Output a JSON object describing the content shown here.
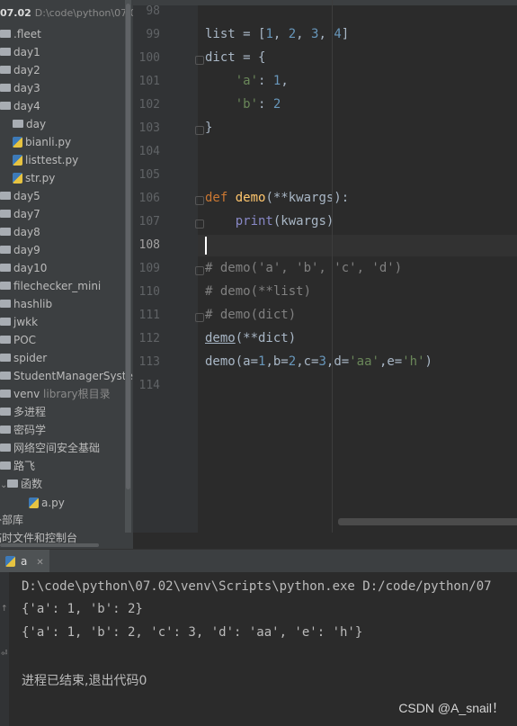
{
  "project": {
    "root_name": "07.02",
    "root_path": "D:\\code\\python\\07.0",
    "items": [
      {
        "label": ".fleet",
        "type": "folder"
      },
      {
        "label": "day1",
        "type": "folder"
      },
      {
        "label": "day2",
        "type": "folder"
      },
      {
        "label": "day3",
        "type": "folder"
      },
      {
        "label": "day4",
        "type": "folder"
      },
      {
        "label": "day",
        "type": "folder"
      },
      {
        "label": "bianli.py",
        "type": "py"
      },
      {
        "label": "listtest.py",
        "type": "py"
      },
      {
        "label": "str.py",
        "type": "py"
      },
      {
        "label": "day5",
        "type": "folder"
      },
      {
        "label": "day7",
        "type": "folder"
      },
      {
        "label": "day8",
        "type": "folder"
      },
      {
        "label": "day9",
        "type": "folder"
      },
      {
        "label": "day10",
        "type": "folder"
      },
      {
        "label": "filechecker_mini",
        "type": "folder"
      },
      {
        "label": "hashlib",
        "type": "folder"
      },
      {
        "label": "jwkk",
        "type": "folder"
      },
      {
        "label": "POC",
        "type": "folder"
      },
      {
        "label": "spider",
        "type": "folder"
      },
      {
        "label": "StudentManagerSystem",
        "type": "folder"
      },
      {
        "label": "venv",
        "type": "folder",
        "note": "library根目录"
      },
      {
        "label": "多进程",
        "type": "folder"
      },
      {
        "label": "密码学",
        "type": "folder"
      },
      {
        "label": "网络空间安全基础",
        "type": "folder"
      },
      {
        "label": "路飞",
        "type": "folder"
      },
      {
        "label": "函数",
        "type": "folder"
      },
      {
        "label": "a.py",
        "type": "py"
      },
      {
        "label": "外部库",
        "type": "lib"
      },
      {
        "label": "临时文件和控制台",
        "type": "lib"
      }
    ]
  },
  "editor": {
    "line_numbers": [
      "98",
      "99",
      "100",
      "101",
      "102",
      "103",
      "104",
      "105",
      "106",
      "107",
      "108",
      "109",
      "110",
      "111",
      "112",
      "113",
      "114"
    ],
    "current_line": "108"
  },
  "run": {
    "tab_label": "a",
    "console": [
      "D:\\code\\python\\07.02\\venv\\Scripts\\python.exe D:/code/python/07",
      "{'a': 1, 'b': 2}",
      "{'a': 1, 'b': 2, 'c': 3, 'd': 'aa', 'e': 'h'}",
      "",
      "进程已结束,退出代码0"
    ]
  },
  "watermark": "CSDN @A_snail！",
  "colors": {
    "keyword": "#cc7832",
    "number": "#6897bb",
    "string": "#6a8759",
    "comment": "#808080",
    "function": "#ffc66d",
    "builtin": "#8888c6"
  }
}
